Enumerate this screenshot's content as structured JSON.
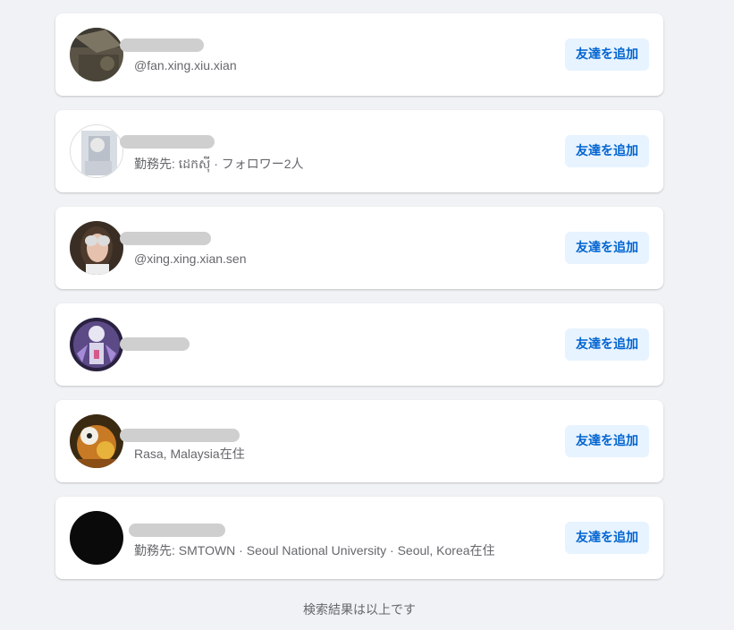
{
  "results": [
    {
      "subtitle": "@fan.xing.xiu.xian",
      "add_label": "友達を追加"
    },
    {
      "subtitle": "勤務先: ដេកស៊ី · フォロワー2人",
      "add_label": "友達を追加"
    },
    {
      "subtitle": "@xing.xing.xian.sen",
      "add_label": "友達を追加"
    },
    {
      "subtitle": "",
      "add_label": "友達を追加"
    },
    {
      "subtitle": "Rasa, Malaysia在住",
      "add_label": "友達を追加"
    },
    {
      "subtitle": "勤務先: SMTOWN · Seoul National University · Seoul, Korea在住",
      "add_label": "友達を追加"
    }
  ],
  "footer_text": "検索結果は以上です",
  "colors": {
    "page_bg": "#f0f2f5",
    "button_bg": "#e7f3ff",
    "button_text": "#0064d1"
  },
  "icons": [
    "avatar-photo"
  ]
}
